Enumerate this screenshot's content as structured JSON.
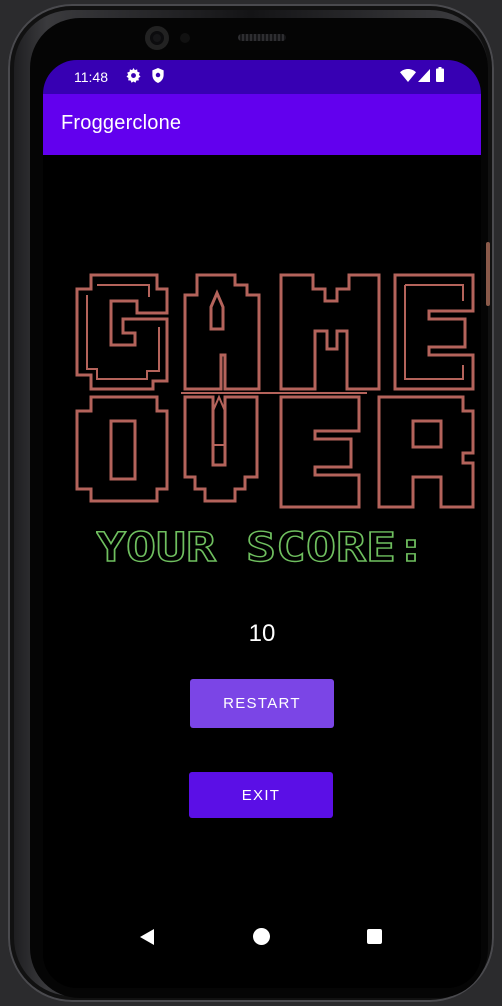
{
  "status_bar": {
    "time": "11:48",
    "left_icons": [
      "gear-icon",
      "shield-icon"
    ],
    "right_icons": [
      "wifi-icon",
      "signal-icon",
      "battery-icon"
    ]
  },
  "app_bar": {
    "title": "Froggerclone",
    "color": "#6200ee"
  },
  "game_over": {
    "line1": "GAME",
    "line2": "OVER",
    "color": "#b4635b"
  },
  "score": {
    "label": "YOUR SCORE:",
    "label_color": "#6fbf5f",
    "value": "10"
  },
  "buttons": {
    "restart": "RESTART",
    "exit": "EXIT",
    "restart_color": "#7b45e6",
    "exit_color": "#5b0fe6"
  },
  "nav_bar": {
    "icons": [
      "back-icon",
      "home-icon",
      "recents-icon"
    ]
  }
}
